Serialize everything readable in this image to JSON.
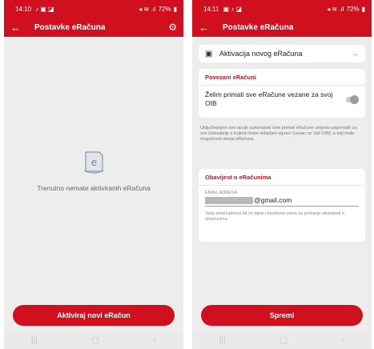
{
  "colors": {
    "brand_red": "#d0101e",
    "section_red": "#c0141f",
    "background": "#ededed"
  },
  "left": {
    "status": {
      "time": "14:10",
      "battery": "72%"
    },
    "appbar": {
      "back_icon": "arrow-left-icon",
      "title": "Postavke eRačuna",
      "settings_icon": "gear-icon"
    },
    "empty_icon": "document-e-icon",
    "empty_text": "Trenutno nemate aktiviranih eRačuna",
    "activate_button": "Aktiviraj novi eRačun"
  },
  "right": {
    "status": {
      "time": "14:11",
      "battery": "72%"
    },
    "appbar": {
      "back_icon": "arrow-left-icon",
      "title": "Postavke eRačuna"
    },
    "activate_row": {
      "icon": "card-icon",
      "label": "Aktivacija novog eRačuna",
      "arrow_icon": "arrow-right-icon"
    },
    "linked": {
      "title": "Povezani eRačuni",
      "toggle_label": "Želim primati sve eRačune vezane za svoj OIB",
      "toggle_on": false
    },
    "info_text": "Uključivanjem ove opcije automatski ćete primati eRačune umjesto papirnatih za sve izdavatelje s kojima imate sklopljen ugovor (vezan uz Vaš OIB), a koji nude mogućnost slanja eRačuna.",
    "notify": {
      "title": "Obavijest o eRačunima",
      "email_label": "EMAIL ADRESA",
      "email_domain": "@gmail.com",
      "email_hint": "Vaša email adresa bit će tajna i korištena samo za primanje obavijesti o eRačunima."
    },
    "save_button": "Spremi"
  }
}
